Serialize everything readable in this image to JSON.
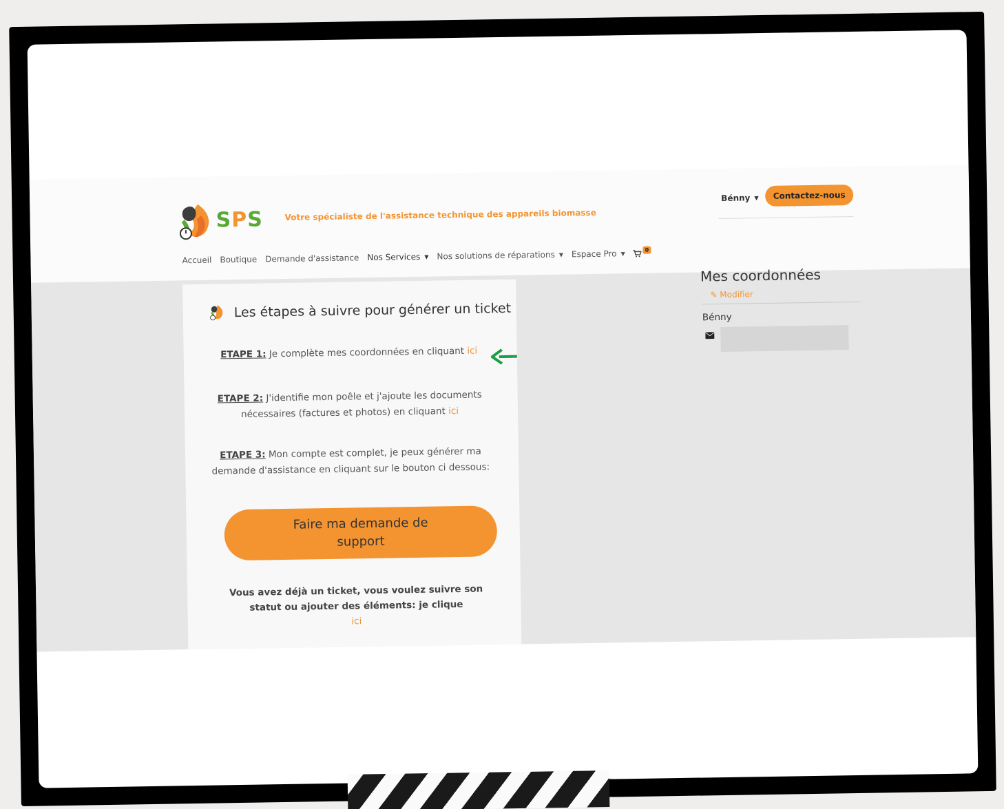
{
  "brand": {
    "logo_text_1": "S",
    "logo_text_2": "P",
    "logo_text_3": "S",
    "tagline": "Votre spécialiste de l'assistance technique des appareils biomasse",
    "green": "#5aa836",
    "orange": "#f39431"
  },
  "header": {
    "user_name": "Bénny",
    "contact_label": "Contactez-nous"
  },
  "nav": {
    "items": [
      "Accueil",
      "Boutique",
      "Demande d'assistance",
      "Nos Services",
      "Nos solutions de réparations",
      "Espace Pro"
    ],
    "cart_count": "0"
  },
  "card": {
    "title": "Les étapes à suivre pour générer un ticket",
    "step1_label": "ETAPE 1:",
    "step1_text": " Je complète mes coordonnées en cliquant ",
    "step2_label": "ETAPE 2:",
    "step2_text": " J'identifie mon poêle et j'ajoute les documents nécessaires (factures et photos) en cliquant ",
    "step3_label": "ETAPE 3:",
    "step3_text": " Mon compte est complet, je peux générer ma demande d'assistance en cliquant sur le bouton ci dessous:",
    "link_label": "ici",
    "support_button": "Faire ma demande de support",
    "note_text": "Vous avez déjà un ticket, vous voulez suivre son statut ou ajouter des éléments: je clique"
  },
  "sidebar": {
    "title": "Mes coordonnées",
    "edit_label": "Modifier",
    "name": "Bénny"
  },
  "icons": {
    "caret": "caret-down-icon",
    "cart": "cart-icon",
    "pencil": "pencil-icon",
    "mail": "envelope-icon",
    "arrow": "arrow-left-icon"
  }
}
